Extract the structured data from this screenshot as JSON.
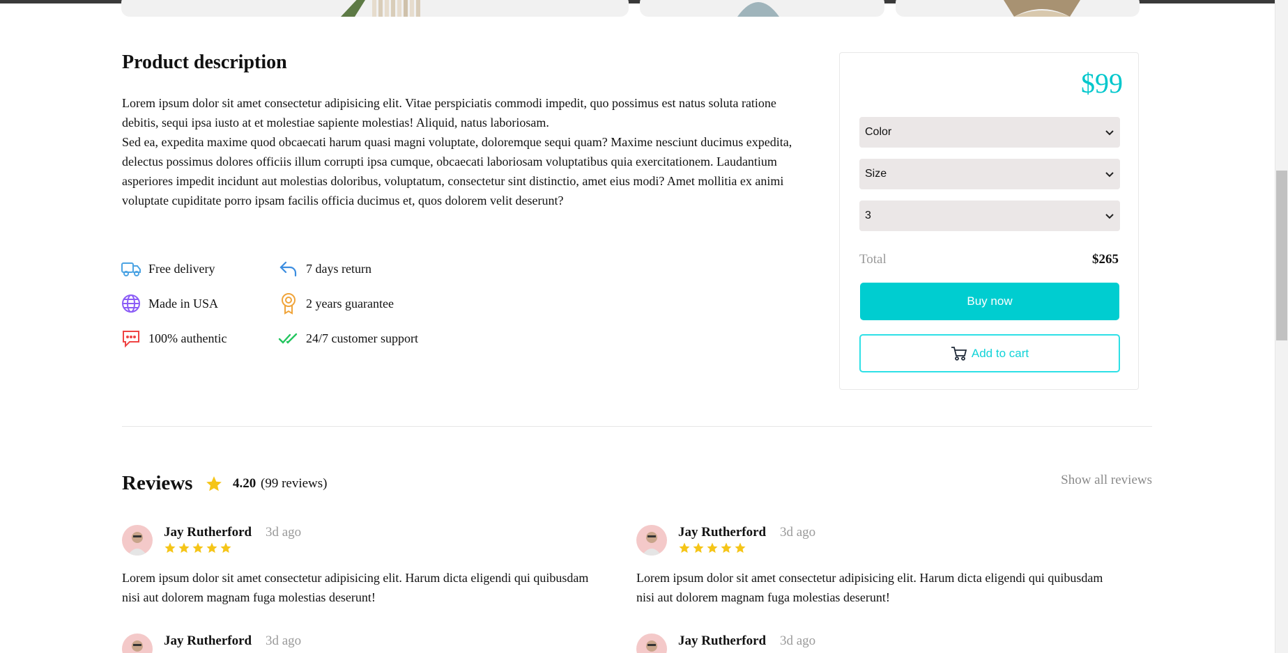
{
  "description": {
    "title": "Product description",
    "paragraph1": "Lorem ipsum dolor sit amet consectetur adipisicing elit. Vitae perspiciatis commodi impedit, quo possimus est natus soluta ratione debitis, sequi ipsa iusto at et molestiae sapiente molestias! Aliquid, natus laboriosam.",
    "paragraph2": "Sed ea, expedita maxime quod obcaecati harum quasi magni voluptate, doloremque sequi quam? Maxime nesciunt ducimus expedita, delectus possimus dolores officiis illum corrupti ipsa cumque, obcaecati laboriosam voluptatibus quia exercitationem. Laudantium asperiores impedit incidunt aut molestias doloribus, voluptatum, consectetur sint distinctio, amet eius modi? Amet mollitia ex animi voluptate cupiditate porro ipsam facilis officia ducimus et, quos dolorem velit deserunt?"
  },
  "features": [
    {
      "label": "Free delivery",
      "icon": "truck-icon",
      "color": "#4ba3e3"
    },
    {
      "label": "7 days return",
      "icon": "return-arrow-icon",
      "color": "#3b8de0"
    },
    {
      "label": "Made in USA",
      "icon": "globe-icon",
      "color": "#8b5cf6"
    },
    {
      "label": "2 years guarantee",
      "icon": "award-icon",
      "color": "#f0a43a"
    },
    {
      "label": "100% authentic",
      "icon": "chat-icon",
      "color": "#ef4444"
    },
    {
      "label": "24/7 customer support",
      "icon": "double-check-icon",
      "color": "#22c55e"
    }
  ],
  "purchase": {
    "price": "$99",
    "color_select": "Color",
    "size_select": "Size",
    "quantity_select": "3",
    "total_label": "Total",
    "total_value": "$265",
    "buy_label": "Buy now",
    "cart_label": "Add to cart",
    "accent_color": "#00cdd0"
  },
  "reviews": {
    "title": "Reviews",
    "rating": "4.20",
    "count": "(99 reviews)",
    "show_all": "Show all reviews",
    "items": [
      {
        "name": "Jay Rutherford",
        "time": "3d ago",
        "stars": 5,
        "text": "Lorem ipsum dolor sit amet consectetur adipisicing elit. Harum dicta eligendi qui quibusdam nisi aut dolorem magnam fuga molestias deserunt!"
      },
      {
        "name": "Jay Rutherford",
        "time": "3d ago",
        "stars": 5,
        "text": "Lorem ipsum dolor sit amet consectetur adipisicing elit. Harum dicta eligendi qui quibusdam nisi aut dolorem magnam fuga molestias deserunt!"
      },
      {
        "name": "Jay Rutherford",
        "time": "3d ago",
        "stars": 5,
        "text": ""
      },
      {
        "name": "Jay Rutherford",
        "time": "3d ago",
        "stars": 5,
        "text": ""
      }
    ],
    "star_color": "#f5c518"
  }
}
